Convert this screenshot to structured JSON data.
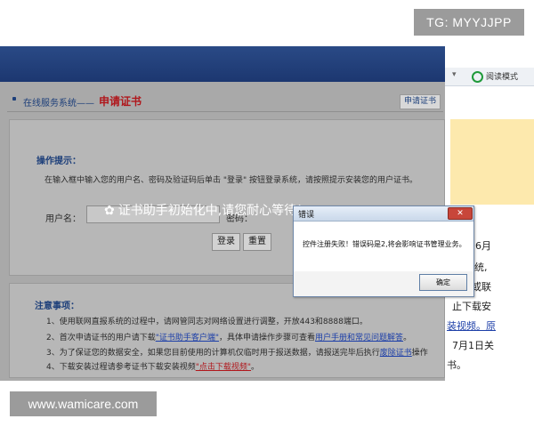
{
  "watermark_top": "TG: MYYJJPP",
  "watermark_bottom": "www.wamicare.com",
  "browser": {
    "reading_mode": "阅读模式",
    "text_fragments": [
      "6月",
      "统,",
      "或联",
      "止下载安",
      "装视频。原",
      "7月1日关",
      "书。"
    ]
  },
  "page": {
    "breadcrumb_prefix": "在线服务系统——",
    "breadcrumb_current": "申请证书",
    "tab_label": "申请证书",
    "tips_heading": "操作提示：",
    "tips_text": "在输入框中输入您的用户名、密码及验证码后单击 \"登录\" 按钮登录系统，请按照提示安装您的用户证书。",
    "username_label": "用户名：",
    "password_label": "密码：",
    "login_button": "登录",
    "reset_button": "重置",
    "loading_text": "证书助手初始化中,请您耐心等待！",
    "notes_heading": "注意事项：",
    "notes": [
      {
        "n": "1、",
        "before": "使用联网直报系统的过程中，请网管同志对网络设置进行调整，开放443和8888端口。"
      },
      {
        "n": "2、",
        "before": "首次申请证书的用户请下载",
        "link1": "\"证书助手客户端\"",
        "mid": "，具体申请操作步骤可查看",
        "link2": "用户手册和常见问题解答",
        "after": "。"
      },
      {
        "n": "3、",
        "before": "为了保证您的数据安全，如果您目前使用的计算机仅临时用于报送数据，请报送完毕后执行",
        "link1": "废除证书",
        "after": "操作"
      },
      {
        "n": "4、",
        "before": "下载安装过程请参考证书下载安装视频",
        "link1": "\"点击下载视频\"",
        "after": "。"
      }
    ]
  },
  "dialog": {
    "title": "错误",
    "close": "✕",
    "message": "控件注册失败！错误码是2,将会影响证书管理业务。",
    "ok_button": "确定"
  },
  "colors": {
    "header_blue": "#1c3770",
    "title_red": "#b0171c",
    "link_blue": "#1d3fa8",
    "dialog_close": "#c8463a"
  },
  "icons": {
    "loading": "spinner-icon",
    "browser_reading": "reading-mode-icon"
  }
}
